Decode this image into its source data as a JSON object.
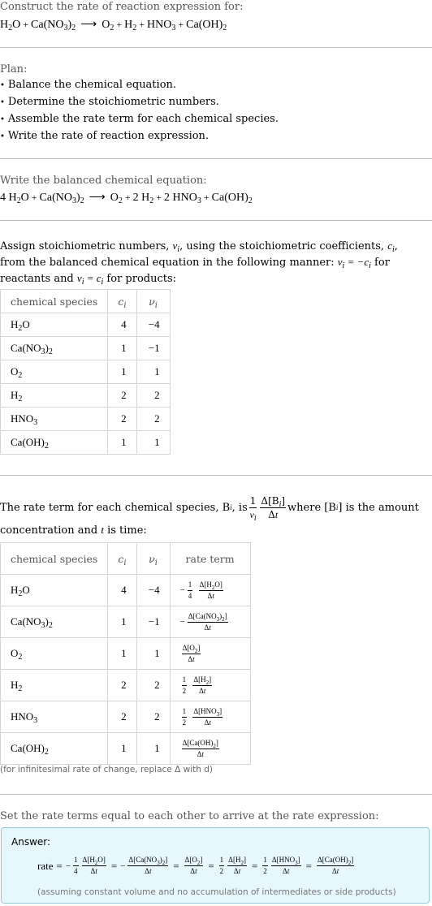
{
  "intro": {
    "label": "Construct the rate of reaction expression for:",
    "equation": {
      "reactants": [
        {
          "base": "H",
          "sub": "2",
          "tail": "O"
        },
        {
          "base": "Ca(NO",
          "sub": "3",
          "tail": ")",
          "sub2": "2"
        }
      ],
      "arrow": "⟶",
      "products": [
        {
          "base": "O",
          "sub": "2"
        },
        {
          "base": "H",
          "sub": "2"
        },
        {
          "base": "HNO",
          "sub": "3"
        },
        {
          "base": "Ca(OH)",
          "sub": "2"
        }
      ],
      "plus": "+"
    }
  },
  "plan": {
    "label": "Plan:",
    "steps": [
      "Balance the chemical equation.",
      "Determine the stoichiometric numbers.",
      "Assemble the rate term for each chemical species.",
      "Write the rate of reaction expression."
    ]
  },
  "balanced": {
    "label": "Write the balanced chemical equation:",
    "coefficients": [
      "4",
      "",
      "",
      "2",
      "2",
      ""
    ]
  },
  "stoich": {
    "text_part1": "Assign stoichiometric numbers, ",
    "nu_i": "νi",
    "text_part2": ", using the stoichiometric coefficients, ",
    "c_i": "ci",
    "text_part3": ", from the balanced chemical equation in the following manner: ",
    "rule_reactants": "νi = −ci",
    "text_part4": " for reactants and ",
    "rule_products": "νi = ci",
    "text_part5": " for products:",
    "table": {
      "headers": [
        "chemical species",
        "ci",
        "νi"
      ],
      "rows": [
        {
          "species": "H2O",
          "c": "4",
          "nu": "−4"
        },
        {
          "species": "Ca(NO3)2",
          "c": "1",
          "nu": "−1"
        },
        {
          "species": "O2",
          "c": "1",
          "nu": "1"
        },
        {
          "species": "H2",
          "c": "2",
          "nu": "2"
        },
        {
          "species": "HNO3",
          "c": "2",
          "nu": "2"
        },
        {
          "species": "Ca(OH)2",
          "c": "1",
          "nu": "1"
        }
      ]
    }
  },
  "rateterm": {
    "text_part1": "The rate term for each chemical species, B",
    "text_part2": ", is ",
    "text_part3": " where [B",
    "text_part4": "] is the amount concentration and ",
    "t": "t",
    "text_part5": " is time:",
    "one": "1",
    "delta_b": "Δ[Bi]",
    "delta_t": "Δt",
    "table": {
      "headers": [
        "chemical species",
        "ci",
        "νi",
        "rate term"
      ],
      "rows": [
        {
          "species": "H2O",
          "c": "4",
          "nu": "−4",
          "sign": "−",
          "coef_num": "1",
          "coef_den": "4",
          "conc": "Δ[H2O]",
          "dt": "Δt"
        },
        {
          "species": "Ca(NO3)2",
          "c": "1",
          "nu": "−1",
          "sign": "−",
          "coef_num": "",
          "coef_den": "",
          "conc": "Δ[Ca(NO3)2]",
          "dt": "Δt"
        },
        {
          "species": "O2",
          "c": "1",
          "nu": "1",
          "sign": "",
          "coef_num": "",
          "coef_den": "",
          "conc": "Δ[O2]",
          "dt": "Δt"
        },
        {
          "species": "H2",
          "c": "2",
          "nu": "2",
          "sign": "",
          "coef_num": "1",
          "coef_den": "2",
          "conc": "Δ[H2]",
          "dt": "Δt"
        },
        {
          "species": "HNO3",
          "c": "2",
          "nu": "2",
          "sign": "",
          "coef_num": "1",
          "coef_den": "2",
          "conc": "Δ[HNO3]",
          "dt": "Δt"
        },
        {
          "species": "Ca(OH)2",
          "c": "1",
          "nu": "1",
          "sign": "",
          "coef_num": "",
          "coef_den": "",
          "conc": "Δ[Ca(OH)2]",
          "dt": "Δt"
        }
      ]
    },
    "note": "(for infinitesimal rate of change, replace Δ with d)"
  },
  "final": {
    "label": "Set the rate terms equal to each other to arrive at the rate expression:",
    "answer_label": "Answer:",
    "rate_word": "rate",
    "equals": "=",
    "note": "(assuming constant volume and no accumulation of intermediates or side products)"
  }
}
